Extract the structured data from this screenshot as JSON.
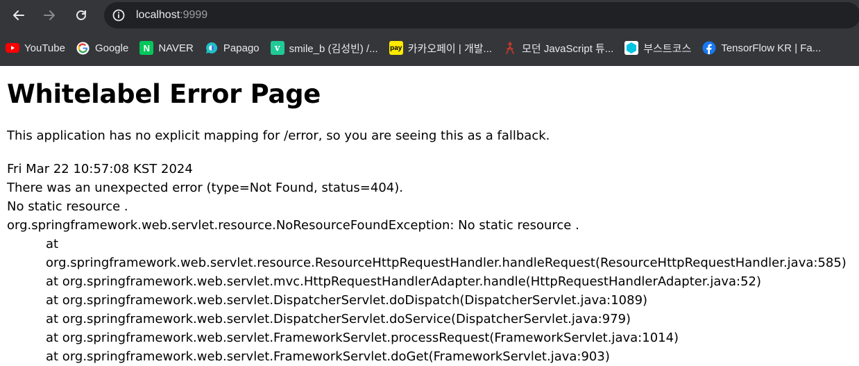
{
  "browser": {
    "url_host": "localhost",
    "url_port": ":9999",
    "bookmarks": [
      {
        "label": "YouTube",
        "icon": "youtube-icon",
        "color": "#ff0000"
      },
      {
        "label": "Google",
        "icon": "google-icon",
        "color": "#4285f4"
      },
      {
        "label": "NAVER",
        "icon": "naver-icon",
        "color": "#03c75a"
      },
      {
        "label": "Papago",
        "icon": "papago-icon",
        "color": "#1fc0c4"
      },
      {
        "label": "smile_b (김성빈) /...",
        "icon": "velog-icon",
        "color": "#20c997"
      },
      {
        "label": "카카오페이 | 개발...",
        "icon": "kakaopay-icon",
        "color": "#ffeb00"
      },
      {
        "label": "모던 JavaScript 튜...",
        "icon": "javascript-info-icon",
        "color": "#c0392b"
      },
      {
        "label": "부스트코스",
        "icon": "boostcourse-icon",
        "color": "#00c4e0"
      },
      {
        "label": "TensorFlow KR | Fa...",
        "icon": "facebook-icon",
        "color": "#1877f2"
      }
    ]
  },
  "page": {
    "title": "Whitelabel Error Page",
    "fallback_message": "This application has no explicit mapping for /error, so you are seeing this as a fallback.",
    "timestamp": "Fri Mar 22 10:57:08 KST 2024",
    "error_line": "There was an unexpected error (type=Not Found, status=404).",
    "message": "No static resource .",
    "exception": "org.springframework.web.servlet.resource.NoResourceFoundException: No static resource .",
    "stack_trace": [
      "at org.springframework.web.servlet.resource.ResourceHttpRequestHandler.handleRequest(ResourceHttpRequestHandler.java:585)",
      "at org.springframework.web.servlet.mvc.HttpRequestHandlerAdapter.handle(HttpRequestHandlerAdapter.java:52)",
      "at org.springframework.web.servlet.DispatcherServlet.doDispatch(DispatcherServlet.java:1089)",
      "at org.springframework.web.servlet.DispatcherServlet.doService(DispatcherServlet.java:979)",
      "at org.springframework.web.servlet.FrameworkServlet.processRequest(FrameworkServlet.java:1014)",
      "at org.springframework.web.servlet.FrameworkServlet.doGet(FrameworkServlet.java:903)"
    ]
  }
}
